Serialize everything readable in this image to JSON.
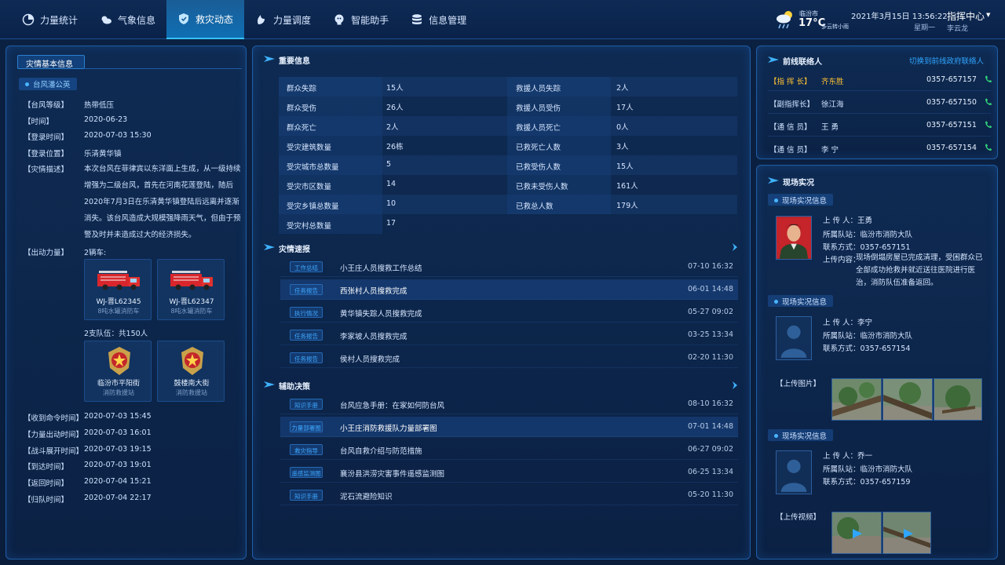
{
  "nav": {
    "items": [
      {
        "label": "力量统计",
        "icon": "chart-icon"
      },
      {
        "label": "气象信息",
        "icon": "weather-icon"
      },
      {
        "label": "救灾动态",
        "icon": "shield-icon",
        "active": true
      },
      {
        "label": "力量调度",
        "icon": "dispatch-icon"
      },
      {
        "label": "智能助手",
        "icon": "assistant-icon"
      },
      {
        "label": "信息管理",
        "icon": "database-icon"
      }
    ]
  },
  "header": {
    "weather_city": "临汾市",
    "weather_temp": "17°C",
    "weather_desc": "多云转小雨",
    "datetime": "2021年3月15日  13:56:22",
    "weekday": "星期一",
    "command_center": "指挥中心",
    "user": "李云龙"
  },
  "left": {
    "title": "灾情基本信息",
    "typhoon_tag": "台风潘公英",
    "fields": [
      {
        "label": "【台风等级】",
        "value": "热带低压"
      },
      {
        "label": "【时间】",
        "value": "2020-06-23"
      },
      {
        "label": "【登录时间】",
        "value": "2020-07-03 15:30"
      },
      {
        "label": "【登录位置】",
        "value": "乐清黄华镇"
      }
    ],
    "desc_label": "【灾情描述】",
    "desc": "本次台风在菲律宾以东洋面上生成，从一级持续增强为二级台风，首先在河南花莲登陆，随后2020年7月3日在乐清黄华镇登陆后远离并逐渐消失。该台风造成大规模强降雨天气，但由于预警及时并未造成过大的经济损失。",
    "force_label": "【出动力量】",
    "force_value": "2辆车:",
    "trucks": [
      {
        "plate": "WJ-晋L62345",
        "type": "8吨水罐消防车"
      },
      {
        "plate": "WJ-晋L62347",
        "type": "8吨水罐消防车"
      }
    ],
    "teams_summary": "2支队伍：共150人",
    "teams": [
      {
        "name": "临汾市平阳街",
        "type": "消防救援站"
      },
      {
        "name": "鼓楼南大街",
        "type": "消防救援站"
      }
    ],
    "times": [
      {
        "label": "【收到命令时间】",
        "value": "2020-07-03 15:45"
      },
      {
        "label": "【力量出动时间】",
        "value": "2020-07-03 16:01"
      },
      {
        "label": "【战斗展开时间】",
        "value": "2020-07-03 19:15"
      },
      {
        "label": "【到达时间】",
        "value": "2020-07-03 19:01"
      },
      {
        "label": "【返回时间】",
        "value": "2020-07-04 15:21"
      },
      {
        "label": "【归队时间】",
        "value": "2020-07-04 22:17"
      }
    ]
  },
  "important": {
    "title": "重要信息",
    "rows": [
      {
        "l1": "群众失踪",
        "v1": "15人",
        "l2": "救援人员失踪",
        "v2": "2人"
      },
      {
        "l1": "群众受伤",
        "v1": "26人",
        "l2": "救援人员受伤",
        "v2": "17人"
      },
      {
        "l1": "群众死亡",
        "v1": "2人",
        "l2": "救援人员死亡",
        "v2": "0人"
      },
      {
        "l1": "受灾建筑数量",
        "v1": "26栋",
        "l2": "已救死亡人数",
        "v2": "3人"
      },
      {
        "l1": "受灾城市总数量",
        "v1": "5",
        "l2": "已救受伤人数",
        "v2": "15人"
      },
      {
        "l1": "受灾市区数量",
        "v1": "14",
        "l2": "已救未受伤人数",
        "v2": "161人"
      },
      {
        "l1": "受灾乡镇总数量",
        "v1": "10",
        "l2": "已救总人数",
        "v2": "179人"
      },
      {
        "l1": "受灾村总数量",
        "v1": "17",
        "l2": "",
        "v2": ""
      }
    ]
  },
  "reports": {
    "title": "灾情速报",
    "items": [
      {
        "tag": "工作总结",
        "text": "小王庄人员搜救工作总结",
        "date": "07-10  16:32"
      },
      {
        "tag": "任务报告",
        "text": "西张村人员搜救完成",
        "date": "06-01  14:48",
        "hl": true
      },
      {
        "tag": "执行情况",
        "text": "黄华镇失踪人员搜救完成",
        "date": "05-27  09:02"
      },
      {
        "tag": "任务报告",
        "text": "李家坡人员搜救完成",
        "date": "03-25  13:34"
      },
      {
        "tag": "任务报告",
        "text": "侯村人员搜救完成",
        "date": "02-20  11:30"
      }
    ]
  },
  "decisions": {
    "title": "辅助决策",
    "items": [
      {
        "tag": "知识手册",
        "text": "台风应急手册：在家如何防台风",
        "date": "08-10  16:32"
      },
      {
        "tag": "力量部署图",
        "text": "小王庄消防救援队力量部署图",
        "date": "07-01  14:48",
        "hl": true
      },
      {
        "tag": "救灾指导",
        "text": "台风自救介绍与防范措施",
        "date": "06-27  09:02"
      },
      {
        "tag": "遥感监测图",
        "text": "襄汾县洪涝灾害事件遥感监测图",
        "date": "06-25  13:34"
      },
      {
        "tag": "知识手册",
        "text": "泥石流避险知识",
        "date": "05-20  11:30"
      }
    ]
  },
  "contacts": {
    "title": "前线联络人",
    "switch": "切换到前线政府联络人",
    "rows": [
      {
        "role": "【指 挥 长】",
        "name": "齐东胜",
        "phone": "0357-657157"
      },
      {
        "role": "【副指挥长】",
        "name": "徐江海",
        "phone": "0357-657150"
      },
      {
        "role": "【通 信 员】",
        "name": "王  勇",
        "phone": "0357-657151"
      },
      {
        "role": "【通 信 员】",
        "name": "李  宁",
        "phone": "0357-657154"
      }
    ]
  },
  "scene": {
    "title": "现场实况",
    "tag": "现场实况信息",
    "entries": [
      {
        "uploader": "上 传 人：王勇",
        "team": "所属队站：临汾市消防大队",
        "phone": "联系方式：0357-657151",
        "content_label": "上传内容：",
        "content": "现场倒塌房屋已完成清理，受困群众已全部成功抢救并就近送往医院进行医治，消防队伍准备返回。"
      },
      {
        "uploader": "上 传 人：李宁",
        "team": "所属队站：临汾市消防大队",
        "phone": "联系方式：0357-657154",
        "media_label": "【上传图片】"
      },
      {
        "uploader": "上 传 人：乔一",
        "team": "所属队站：临汾市消防大队",
        "phone": "联系方式：0357-657159",
        "media_label": "【上传视频】"
      }
    ]
  },
  "colors": {
    "accent": "#2fa6ff",
    "highlight": "#ffc233",
    "active_tab": "#1a5d97"
  }
}
